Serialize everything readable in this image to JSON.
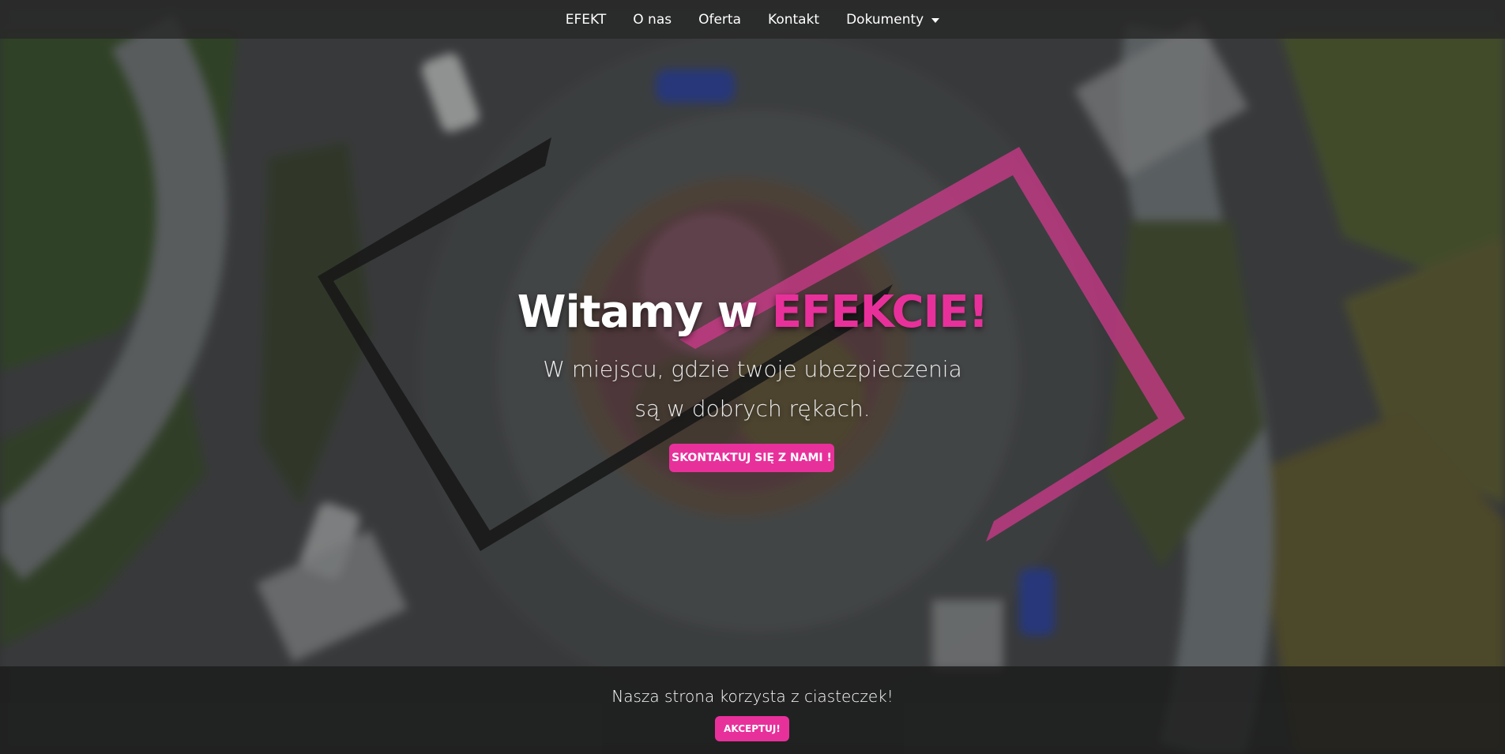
{
  "nav": {
    "items": [
      {
        "label": "EFEKT"
      },
      {
        "label": "O nas"
      },
      {
        "label": "Oferta"
      },
      {
        "label": "Kontakt"
      },
      {
        "label": "Dokumenty",
        "has_dropdown": true
      }
    ]
  },
  "hero": {
    "title_main": "Witamy w ",
    "title_accent": "EFEKCIE!",
    "subtitle_line1": "W miejscu, gdzie twoje ubezpieczenia",
    "subtitle_line2": "są w dobrych rękach.",
    "cta_label": "SKONTAKTUJ SIĘ Z NAMI !",
    "background": "aerial view of a roundabout"
  },
  "cookie_bar": {
    "message": "Nasza strona korzysta z ciasteczek!",
    "accept_label": "AKCEPTUJ!"
  },
  "colors": {
    "accent": "#e8309b",
    "navbar_bg": "#282828",
    "text": "#ffffff"
  },
  "icons": {
    "dropdown": "caret-down-icon"
  }
}
